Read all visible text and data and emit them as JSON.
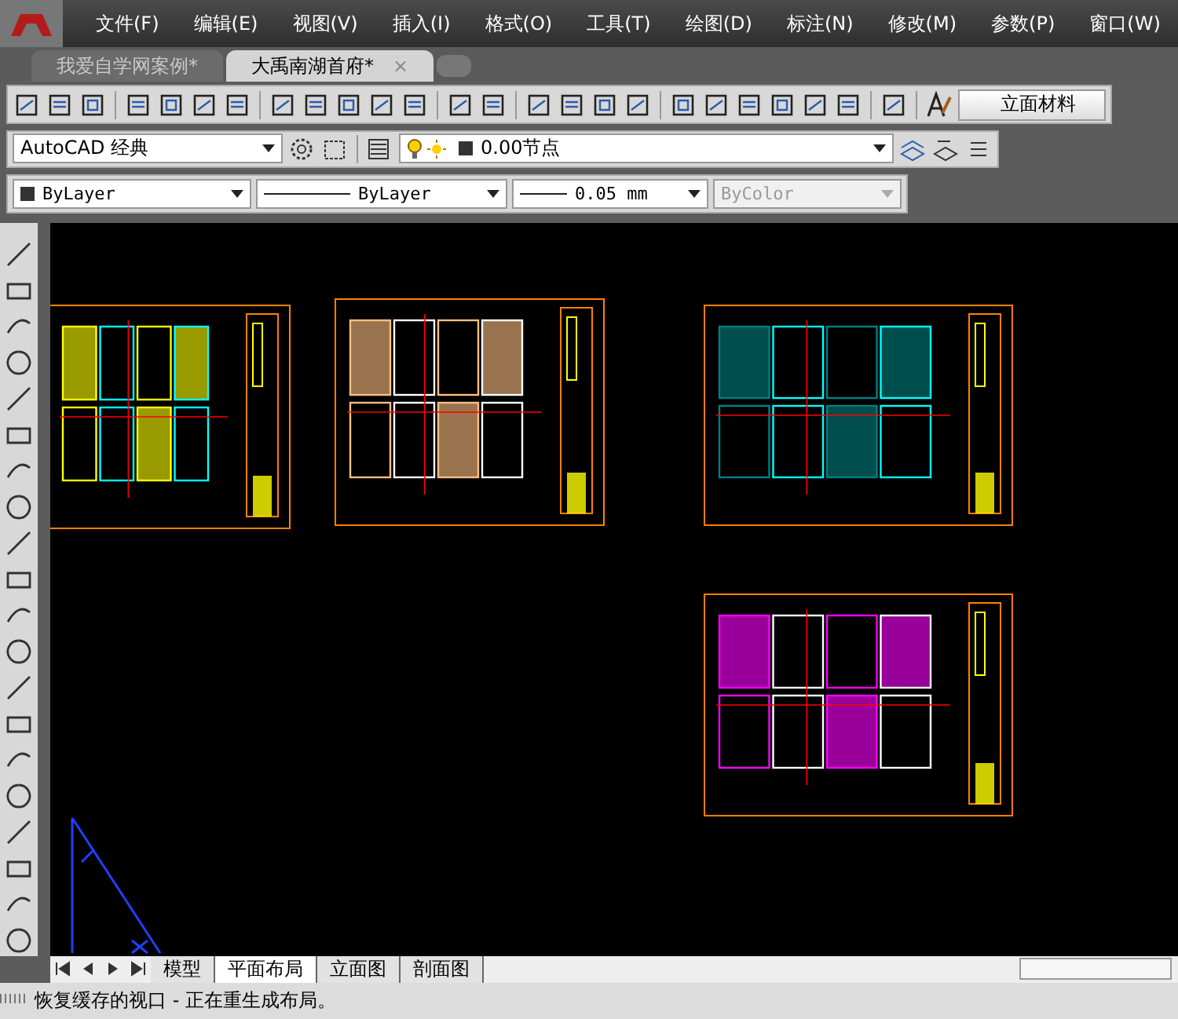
{
  "menu": [
    "文件(F)",
    "编辑(E)",
    "视图(V)",
    "插入(I)",
    "格式(O)",
    "工具(T)",
    "绘图(D)",
    "标注(N)",
    "修改(M)",
    "参数(P)",
    "窗口(W)"
  ],
  "doc_tabs": [
    {
      "label": "我爱自学网案例*",
      "selected": false
    },
    {
      "label": "大禹南湖首府*",
      "selected": true
    }
  ],
  "doc_tab_close": "×",
  "materials_button": "立面材料",
  "workspace": "AutoCAD 经典",
  "layer": "0.00节点",
  "properties": {
    "color_setting": "ByLayer",
    "linetype": "ByLayer",
    "lineweight": "0.05 mm",
    "plotstyle": "ByColor",
    "plotstyle_disabled": true
  },
  "layout_tabs": [
    {
      "label": "模型",
      "selected": false
    },
    {
      "label": "平面布局",
      "selected": true
    },
    {
      "label": "立面图",
      "selected": false
    },
    {
      "label": "剖面图",
      "selected": false
    }
  ],
  "command_line": "恢复缓存的视口  -  正在重生成布局。"
}
